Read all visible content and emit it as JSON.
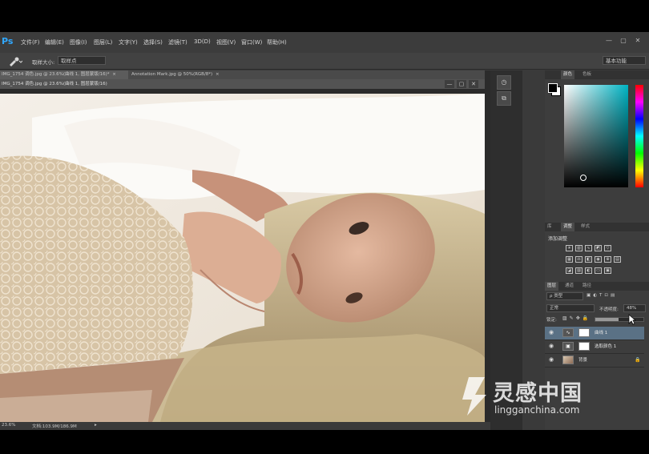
{
  "app": {
    "logo": "Ps",
    "accent": "#31a8ff"
  },
  "menu": [
    "文件(F)",
    "编辑(E)",
    "图像(I)",
    "图层(L)",
    "文字(Y)",
    "选择(S)",
    "滤镜(T)",
    "3D(D)",
    "视图(V)",
    "窗口(W)",
    "帮助(H)"
  ],
  "window_controls": [
    "—",
    "▢",
    "✕"
  ],
  "options_bar": {
    "tool_icon": "eyedropper-icon",
    "sample_label": "取样大小:",
    "sample_value": "取样点",
    "workspace": "基本功能"
  },
  "doc_tabs": [
    {
      "label": "IMG_1754 调色.jpg @ 23.6%(曲线 1, 图层蒙版/16)*",
      "close": "×"
    },
    {
      "label": "Annotation Mark.jpg @ 50%(RGB/8*)",
      "close": "×"
    }
  ],
  "doc_title": "IMG_1754 调色.jpg @ 23.6%(曲线 1, 图层蒙版/16)",
  "doc_controls": [
    "—",
    "▢",
    "✕"
  ],
  "status": {
    "zoom": "23.6%",
    "doc_info": "文档:103.9M/186.9M"
  },
  "color_panel": {
    "tabs": [
      "颜色",
      "色板"
    ],
    "foreground": "#000000",
    "background": "#ffffff"
  },
  "adjust_panel": {
    "tabs": [
      "库",
      "调整",
      "样式"
    ],
    "title": "添加调整"
  },
  "layers_panel": {
    "tabs": [
      "图层",
      "通道",
      "路径"
    ],
    "kind_filter": "ρ 类型",
    "blend_mode": "正常",
    "opacity_label": "不透明度:",
    "opacity_value": "48%",
    "lock_label": "锁定:",
    "fill_label": "填充:",
    "layers": [
      {
        "name": "曲线 1",
        "selected": true
      },
      {
        "name": "选取颜色 1",
        "selected": false
      },
      {
        "name": "背景",
        "selected": false
      }
    ]
  },
  "watermark": {
    "cn": "灵感中国",
    "en": "lingganchina.com"
  }
}
